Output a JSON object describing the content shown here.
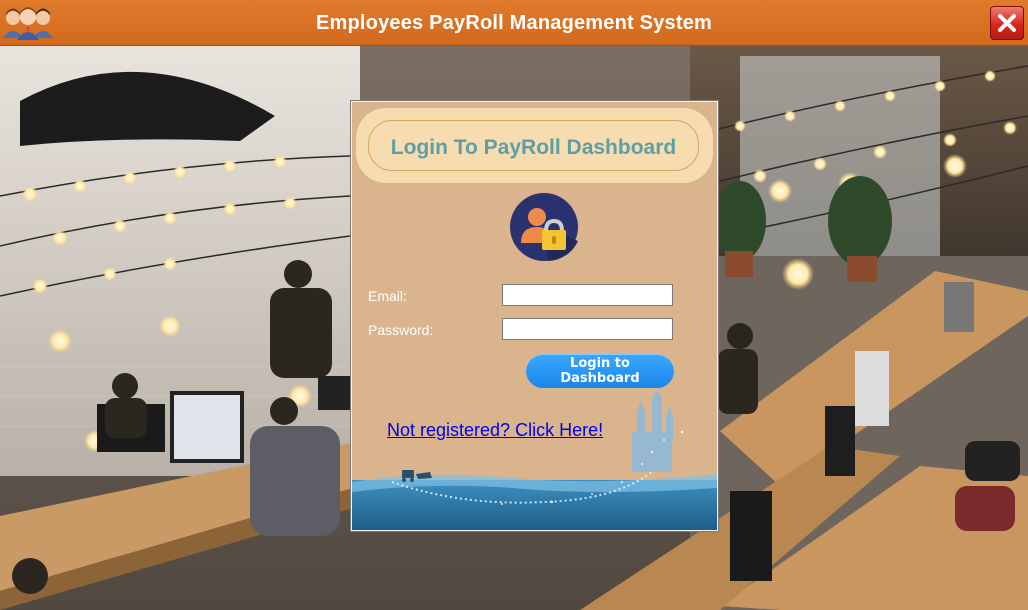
{
  "window": {
    "title": "Employees PayRoll Management System"
  },
  "login": {
    "heading": "Login To PayRoll Dashboard",
    "email_label": "Email:",
    "email_value": "",
    "password_label": "Password:",
    "password_value": "",
    "submit_label": "Login to Dashboard",
    "register_link": "Not registered? Click Here!"
  },
  "icons": {
    "app_logo": "team-people-icon",
    "close": "close-icon",
    "user_lock": "user-lock-icon"
  },
  "colors": {
    "titlebar": "#d9701f",
    "panel": "#d9b48d",
    "panel_header": "#f6dcae",
    "heading_text": "#5f9ea7",
    "button": "#2a95f5",
    "link": "#0000ee"
  }
}
